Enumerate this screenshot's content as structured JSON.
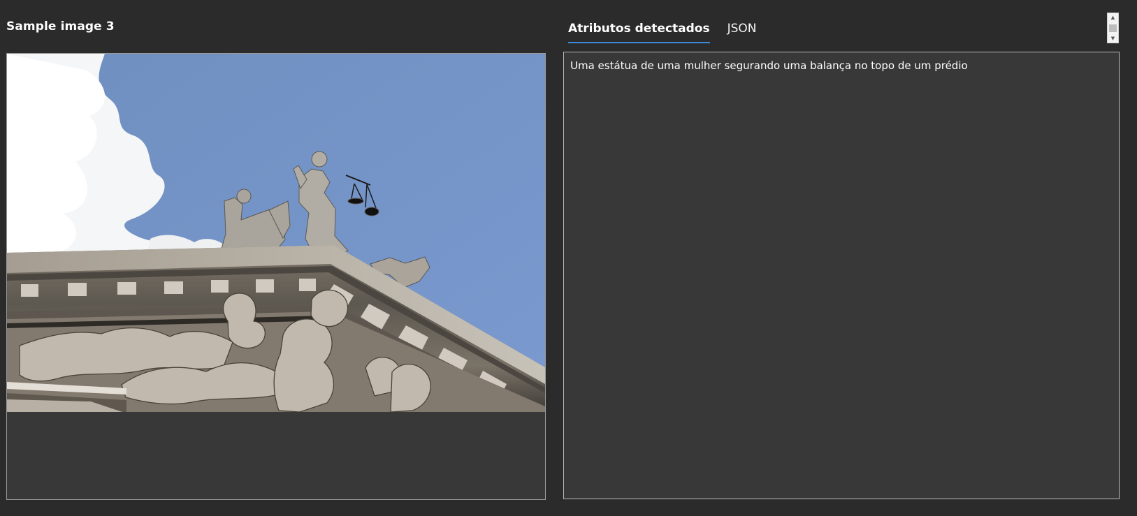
{
  "left_panel": {
    "title": "Sample image 3"
  },
  "right_panel": {
    "tabs": [
      {
        "label": "Atributos detectados",
        "active": true
      },
      {
        "label": "JSON",
        "active": false
      }
    ],
    "caption": "Uma estátua de uma mulher segurando uma balança no topo de um prédio"
  },
  "colors": {
    "background": "#2b2b2b",
    "panel": "#383838",
    "tab_underline": "#3d8bd8",
    "sky": "#7799c8"
  },
  "icons": {
    "scroll_up": "triangle-up-icon",
    "scroll_down": "triangle-down-icon"
  }
}
